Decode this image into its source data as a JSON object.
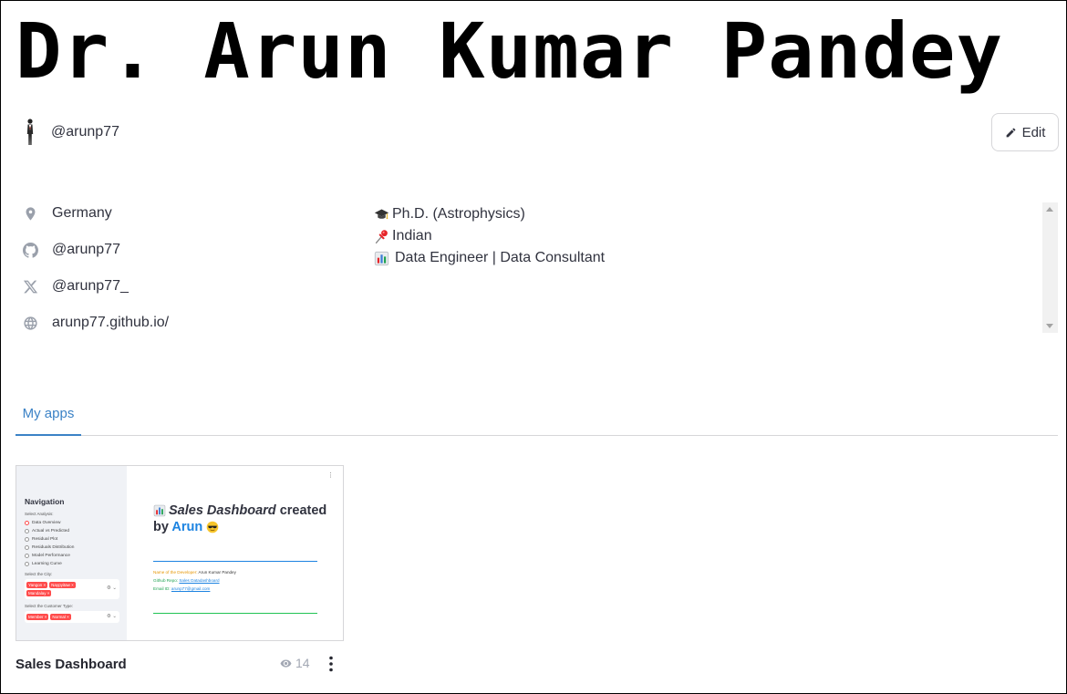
{
  "profile": {
    "display_name": "Dr. Arun Kumar Pandey",
    "username": "@arunp77",
    "edit_label": "Edit"
  },
  "info": [
    {
      "icon": "location-pin-icon",
      "text": "Germany"
    },
    {
      "icon": "github-icon",
      "text": "@arunp77"
    },
    {
      "icon": "x-twitter-icon",
      "text": "@arunp77_"
    },
    {
      "icon": "globe-icon",
      "text": "arunp77.github.io/"
    }
  ],
  "bio": [
    {
      "icon": "graduation-cap-emoji",
      "text": "Ph.D. (Astrophysics)"
    },
    {
      "icon": "pushpin-emoji",
      "text": "Indian"
    },
    {
      "icon": "bar-chart-emoji",
      "text": "Data Engineer | Data Consultant"
    }
  ],
  "tabs": [
    {
      "label": "My apps",
      "active": true
    }
  ],
  "apps": [
    {
      "name": "Sales Dashboard",
      "views": "14",
      "thumbnail": {
        "sidebar_title": "Navigation",
        "select_analysis_label": "Select Analysis:",
        "analysis_options": [
          "Data Overview",
          "Actual vs Predicted",
          "Residual Plot",
          "Residuals Distribution",
          "Model Performance",
          "Learning Curve"
        ],
        "selected_option": "Data Overview",
        "city_label": "Select the City:",
        "city_tags": [
          "Yangon",
          "Naypyitaw",
          "Mandalay"
        ],
        "customer_label": "Select the Customer Type:",
        "customer_tags": [
          "Member",
          "Normal"
        ],
        "title_prefix": "Sales Dashboard",
        "title_mid": " created by ",
        "title_name": "Arun",
        "developer_label": "Name of the Developer:",
        "developer_value": "Arun Kumar Pandey",
        "github_label": "Github Repo:",
        "github_value": "Sales Datadashboard",
        "email_label": "Email ID:",
        "email_value": "arunp77@gmail.com"
      }
    }
  ],
  "colors": {
    "accent": "#3b82c6",
    "tag": "#ff4b4b",
    "muted": "#a3a8b4"
  }
}
